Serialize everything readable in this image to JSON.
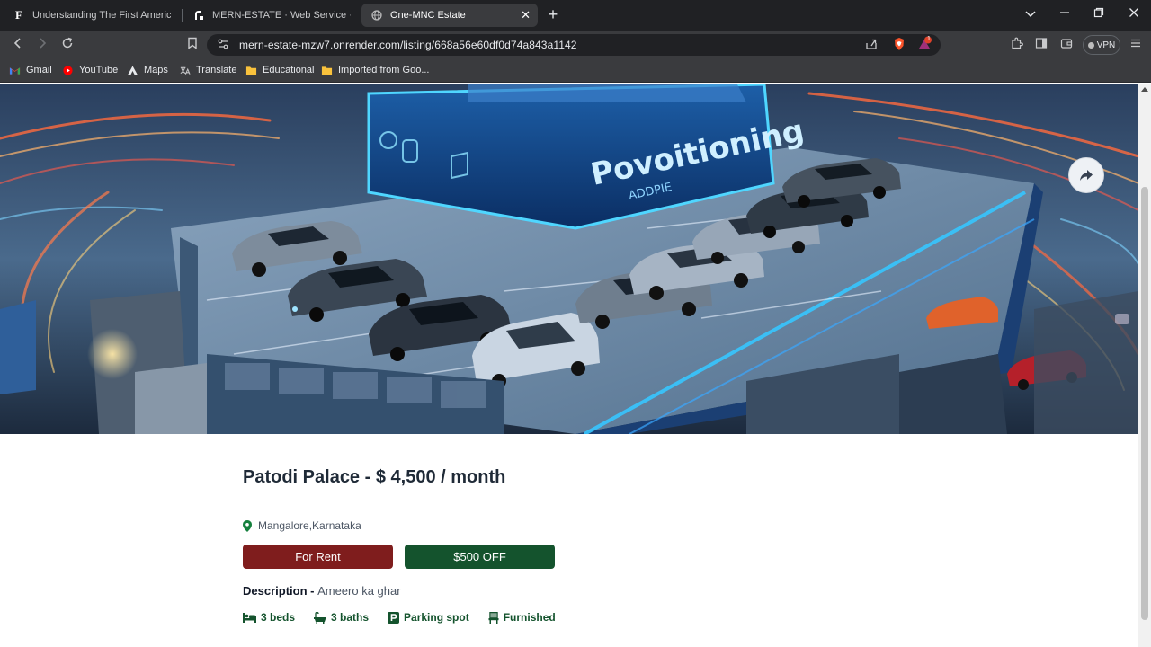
{
  "browser": {
    "tabs": [
      {
        "title": "Understanding The First American Fi",
        "favicon": "F"
      },
      {
        "title": "MERN-ESTATE · Web Service · Rend",
        "favicon": "render-icon"
      },
      {
        "title": "One-MNC Estate",
        "favicon": "globe-icon"
      }
    ],
    "url": "mern-estate-mzw7.onrender.com/listing/668a56e60df0d74a843a1142",
    "notification_count": "1",
    "vpn_label": "VPN",
    "bookmarks": [
      {
        "label": "Gmail"
      },
      {
        "label": "YouTube"
      },
      {
        "label": "Maps"
      },
      {
        "label": "Translate"
      },
      {
        "label": "Educational"
      },
      {
        "label": "Imported from Goo..."
      }
    ]
  },
  "hero": {
    "sign_text": "Povoitioning",
    "sign_subtext": "ADDPIE"
  },
  "listing": {
    "title": "Patodi Palace - $ 4,500 / month",
    "address": "Mangalore,Karnataka",
    "type_label": "For Rent",
    "discount_label": "$500 OFF",
    "description_label": "Description - ",
    "description_text": "Ameero ka ghar",
    "features": [
      {
        "label": "3 beds",
        "icon": "bed-icon"
      },
      {
        "label": "3 baths",
        "icon": "bath-icon"
      },
      {
        "label": "Parking spot",
        "icon": "parking-icon"
      },
      {
        "label": "Furnished",
        "icon": "chair-icon"
      }
    ]
  },
  "colors": {
    "rent_badge": "#7f1d1d",
    "discount_badge": "#14532d",
    "feature_text": "#14532d"
  }
}
